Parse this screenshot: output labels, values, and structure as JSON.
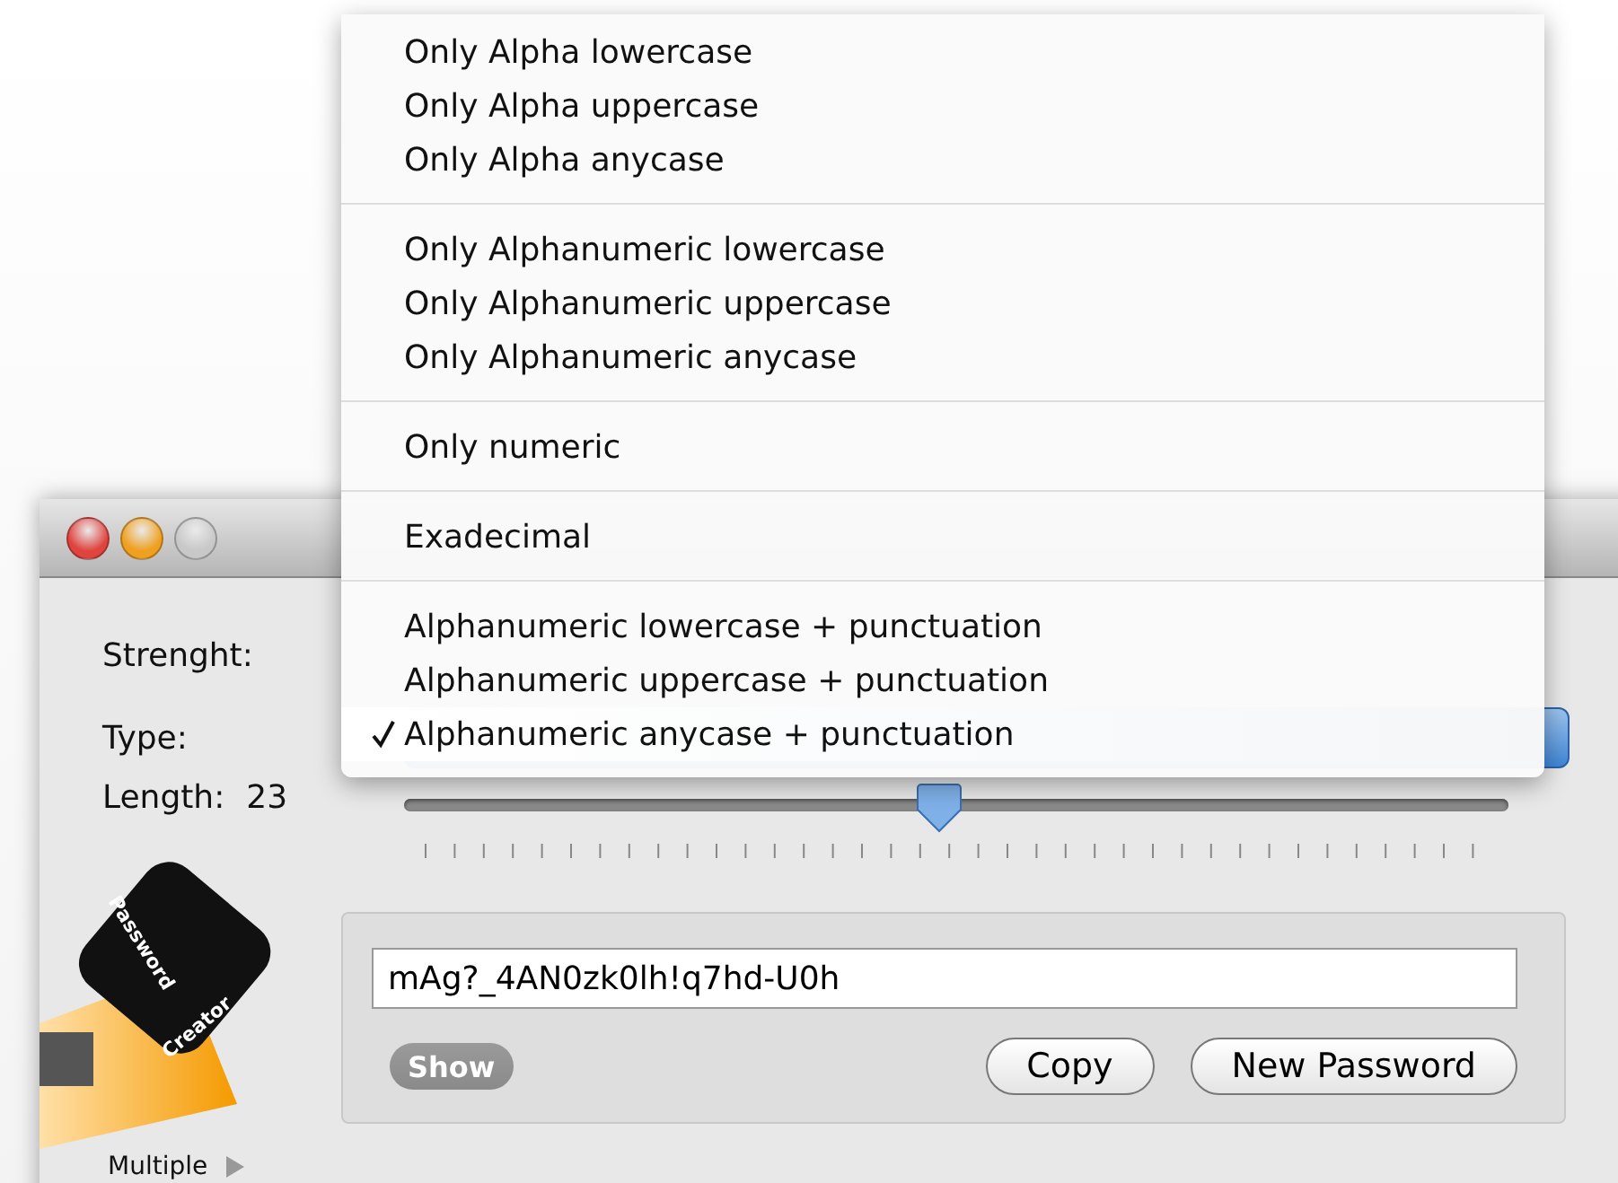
{
  "window": {
    "traffic_lights": [
      {
        "kind": "close",
        "disabled": false
      },
      {
        "kind": "minimize",
        "disabled": false
      },
      {
        "kind": "zoom",
        "disabled": true
      }
    ]
  },
  "menu": {
    "groups": [
      {
        "items": [
          {
            "label": "Only Alpha lowercase",
            "selected": false
          },
          {
            "label": "Only Alpha uppercase",
            "selected": false
          },
          {
            "label": "Only Alpha anycase",
            "selected": false
          }
        ]
      },
      {
        "items": [
          {
            "label": "Only Alphanumeric lowercase",
            "selected": false
          },
          {
            "label": "Only Alphanumeric uppercase",
            "selected": false
          },
          {
            "label": "Only Alphanumeric anycase",
            "selected": false
          }
        ]
      },
      {
        "items": [
          {
            "label": "Only numeric",
            "selected": false
          }
        ]
      },
      {
        "items": [
          {
            "label": "Exadecimal",
            "selected": false
          }
        ]
      },
      {
        "items": [
          {
            "label": "Alphanumeric lowercase + punctuation",
            "selected": false
          },
          {
            "label": "Alphanumeric uppercase + punctuation",
            "selected": false
          },
          {
            "label": "Alphanumeric anycase + punctuation",
            "selected": true
          }
        ]
      }
    ]
  },
  "form": {
    "strength_label": "Strenght:",
    "type_label": "Type:",
    "length_label": "Length:",
    "length_value": "23",
    "length_slider": {
      "level": 0.485
    }
  },
  "logo": {
    "texts": [
      "Password",
      "Creator"
    ]
  },
  "multiple": {
    "label": "Multiple"
  },
  "password": {
    "value": "mAg?_4AN0zk0lh!q7hd-U0h",
    "buttons": [
      {
        "label": "Show",
        "kind": "toggle"
      },
      {
        "label": "Copy",
        "kind": "push"
      },
      {
        "label": "New Password",
        "kind": "push"
      }
    ]
  }
}
